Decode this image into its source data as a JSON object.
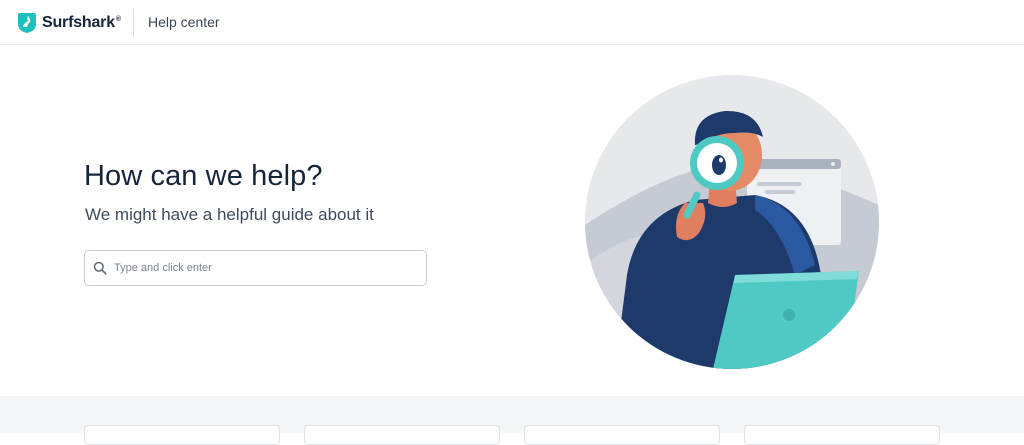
{
  "header": {
    "brand_name": "Surfshark",
    "brand_registered": "®",
    "section_title": "Help center",
    "brand_color": "#1ebfbf"
  },
  "hero": {
    "title": "How can we help?",
    "subtitle": "We might have a helpful guide about it",
    "search": {
      "placeholder": "Type and click enter",
      "value": ""
    }
  },
  "illustration": {
    "subject": "person-with-magnifying-glass-and-laptop"
  },
  "colors": {
    "text_dark": "#16253b",
    "accent_teal": "#4fc9c4",
    "illustration_navy": "#1e3a6b",
    "section_bg": "#f4f5f7"
  }
}
